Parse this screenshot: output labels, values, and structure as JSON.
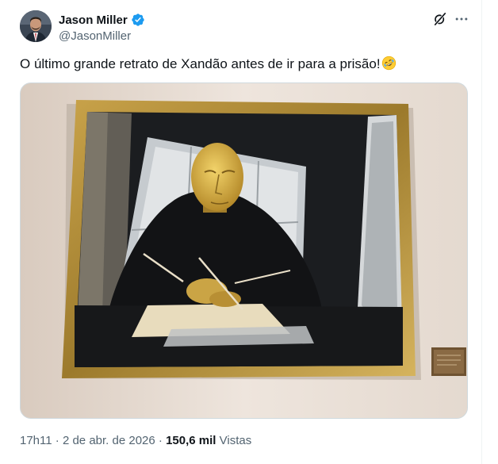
{
  "author": {
    "name": "Jason Miller",
    "handle": "@JasonMiller",
    "verified": true,
    "verified_color": "#1d9bf0"
  },
  "header_icons": [
    "grok-icon",
    "more-icon"
  ],
  "tweet": {
    "text": "O último grande retrato de Xandão antes de ir para a prisão!",
    "emoji": "rolling-on-the-floor-laughing-emoji",
    "media": {
      "kind": "photo",
      "subject": "painting-in-gold-frame"
    }
  },
  "meta": {
    "time": "17h11",
    "separator": " · ",
    "date": "2 de abr. de 2026",
    "views_count": "150,6 mil",
    "views_label": "Vistas"
  },
  "colors": {
    "text_primary": "#0f1419",
    "text_secondary": "#536471",
    "border": "#cfd9de"
  }
}
